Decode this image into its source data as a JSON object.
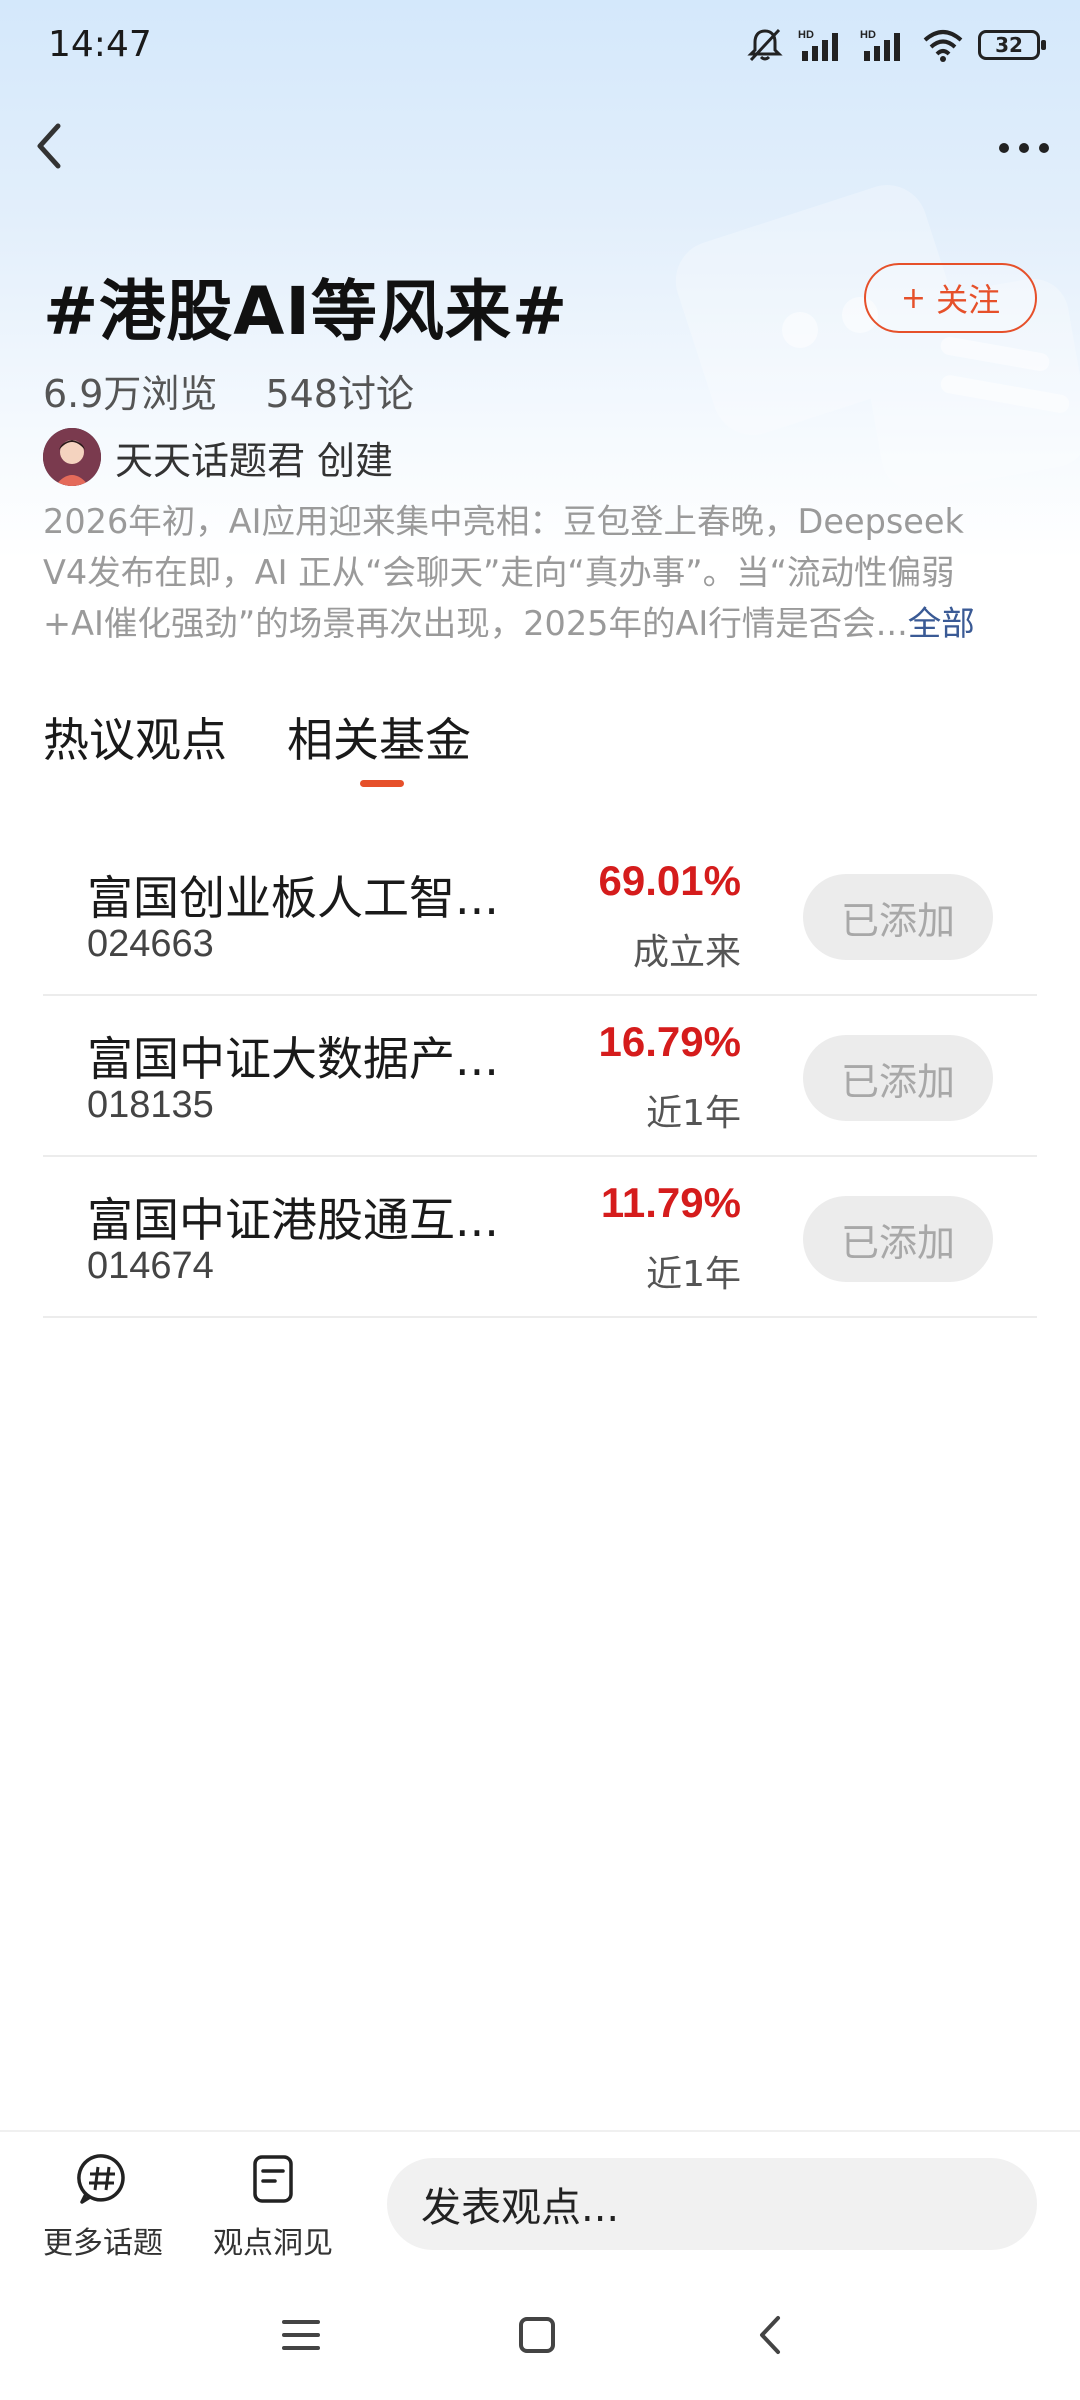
{
  "status_bar": {
    "time": "14:47",
    "signal_label_1": "HD",
    "signal_label_2": "HD",
    "battery": "32",
    "icons": [
      "mute-bell-icon",
      "signal-icon",
      "signal-icon",
      "wifi-icon",
      "battery-icon"
    ]
  },
  "nav": {
    "back_icon": "chevron-left-icon",
    "more_icon": "more-dots-icon"
  },
  "topic": {
    "title": "#港股AI等风来#",
    "follow_label": "关注",
    "follow_plus": "+",
    "views": "6.9万浏览",
    "discussions": "548讨论",
    "creator_name": "天天话题君",
    "creator_suffix": "创建",
    "description_lines": [
      "2026年初，AI应用迎来集中亮相：豆包登上春晚，Deepseek",
      "V4发布在即，AI 正从“会聊天”走向“真办事”。当“流动性偏弱",
      "+AI催化强劲”的场景再次出现，2025年的AI行情是否会..."
    ],
    "description_more": "全部"
  },
  "tabs": [
    {
      "label": "热议观点",
      "active": false
    },
    {
      "label": "相关基金",
      "active": true
    }
  ],
  "accent_color": "#e6502a",
  "funds": [
    {
      "name": "富国创业板人工智...",
      "code": "024663",
      "return": "69.01%",
      "period": "成立来",
      "button": "已添加"
    },
    {
      "name": "富国中证大数据产...",
      "code": "018135",
      "return": "16.79%",
      "period": "近1年",
      "button": "已添加"
    },
    {
      "name": "富国中证港股通互...",
      "code": "014674",
      "return": "11.79%",
      "period": "近1年",
      "button": "已添加"
    }
  ],
  "bottom_bar": {
    "more_topics": "更多话题",
    "insights": "观点洞见",
    "post_placeholder": "发表观点..."
  },
  "system_nav": [
    "menu-icon",
    "home-icon",
    "back-icon"
  ]
}
